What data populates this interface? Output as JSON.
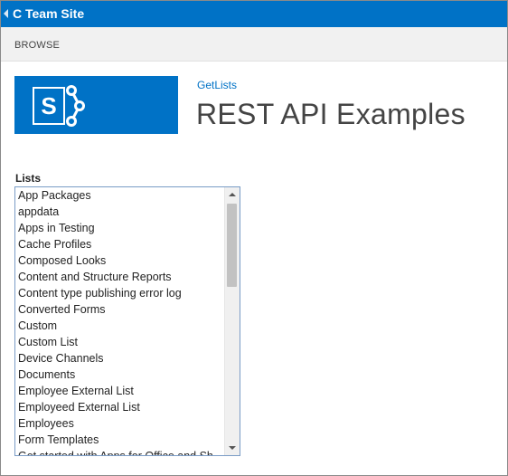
{
  "suite_bar": {
    "site_title": "C Team Site",
    "back_icon": "back-arrow-icon",
    "color": "#0072c6"
  },
  "ribbon": {
    "tabs": [
      {
        "label": "BROWSE"
      }
    ]
  },
  "header": {
    "logo_icon": "sharepoint-logo-icon",
    "breadcrumb_link": "GetLists",
    "page_title": "REST API Examples"
  },
  "lists_panel": {
    "label": "Lists",
    "items": [
      "App Packages",
      "appdata",
      "Apps in Testing",
      "Cache Profiles",
      "Composed Looks",
      "Content and Structure Reports",
      "Content type publishing error log",
      "Converted Forms",
      "Custom",
      "Custom List",
      "Device Channels",
      "Documents",
      "Employee External List",
      "Employeed External List",
      "Employees",
      "Form Templates",
      "Get started with Apps for Office and Sh"
    ]
  }
}
